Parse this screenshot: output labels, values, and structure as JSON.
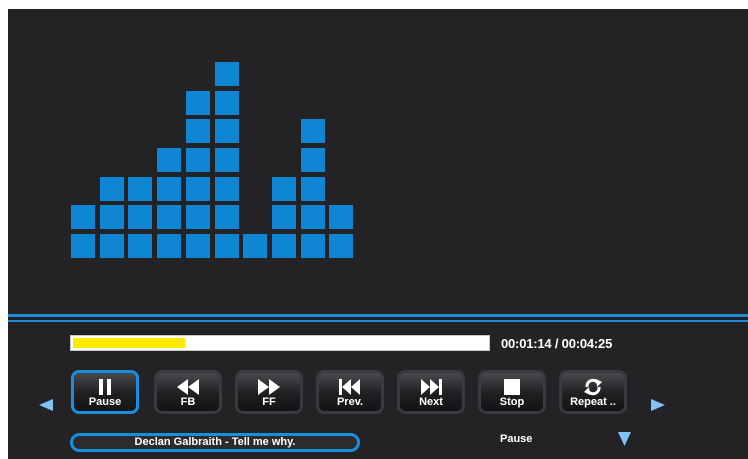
{
  "visualizer": {
    "levels": [
      2,
      3,
      3,
      4,
      6,
      7,
      1,
      3,
      5,
      2
    ]
  },
  "progress": {
    "fraction": 0.27,
    "time_text": "00:01:14 / 00:04:25",
    "fill_color": "#ffea00"
  },
  "controls": {
    "pause": {
      "label": "Pause",
      "icon": "pause-icon"
    },
    "fb": {
      "label": "FB",
      "icon": "rewind-icon"
    },
    "ff": {
      "label": "FF",
      "icon": "fast-forward-icon"
    },
    "prev": {
      "label": "Prev.",
      "icon": "skip-previous-icon"
    },
    "next": {
      "label": "Next",
      "icon": "skip-next-icon"
    },
    "stop": {
      "label": "Stop",
      "icon": "stop-icon"
    },
    "repeat": {
      "label": "Repeat ..",
      "icon": "repeat-icon"
    }
  },
  "now_playing": "Declan Galbraith - Tell me why.",
  "status": "Pause",
  "colors": {
    "accent": "#1a8fe0",
    "background": "#232326",
    "bar": "#0e86d4"
  }
}
